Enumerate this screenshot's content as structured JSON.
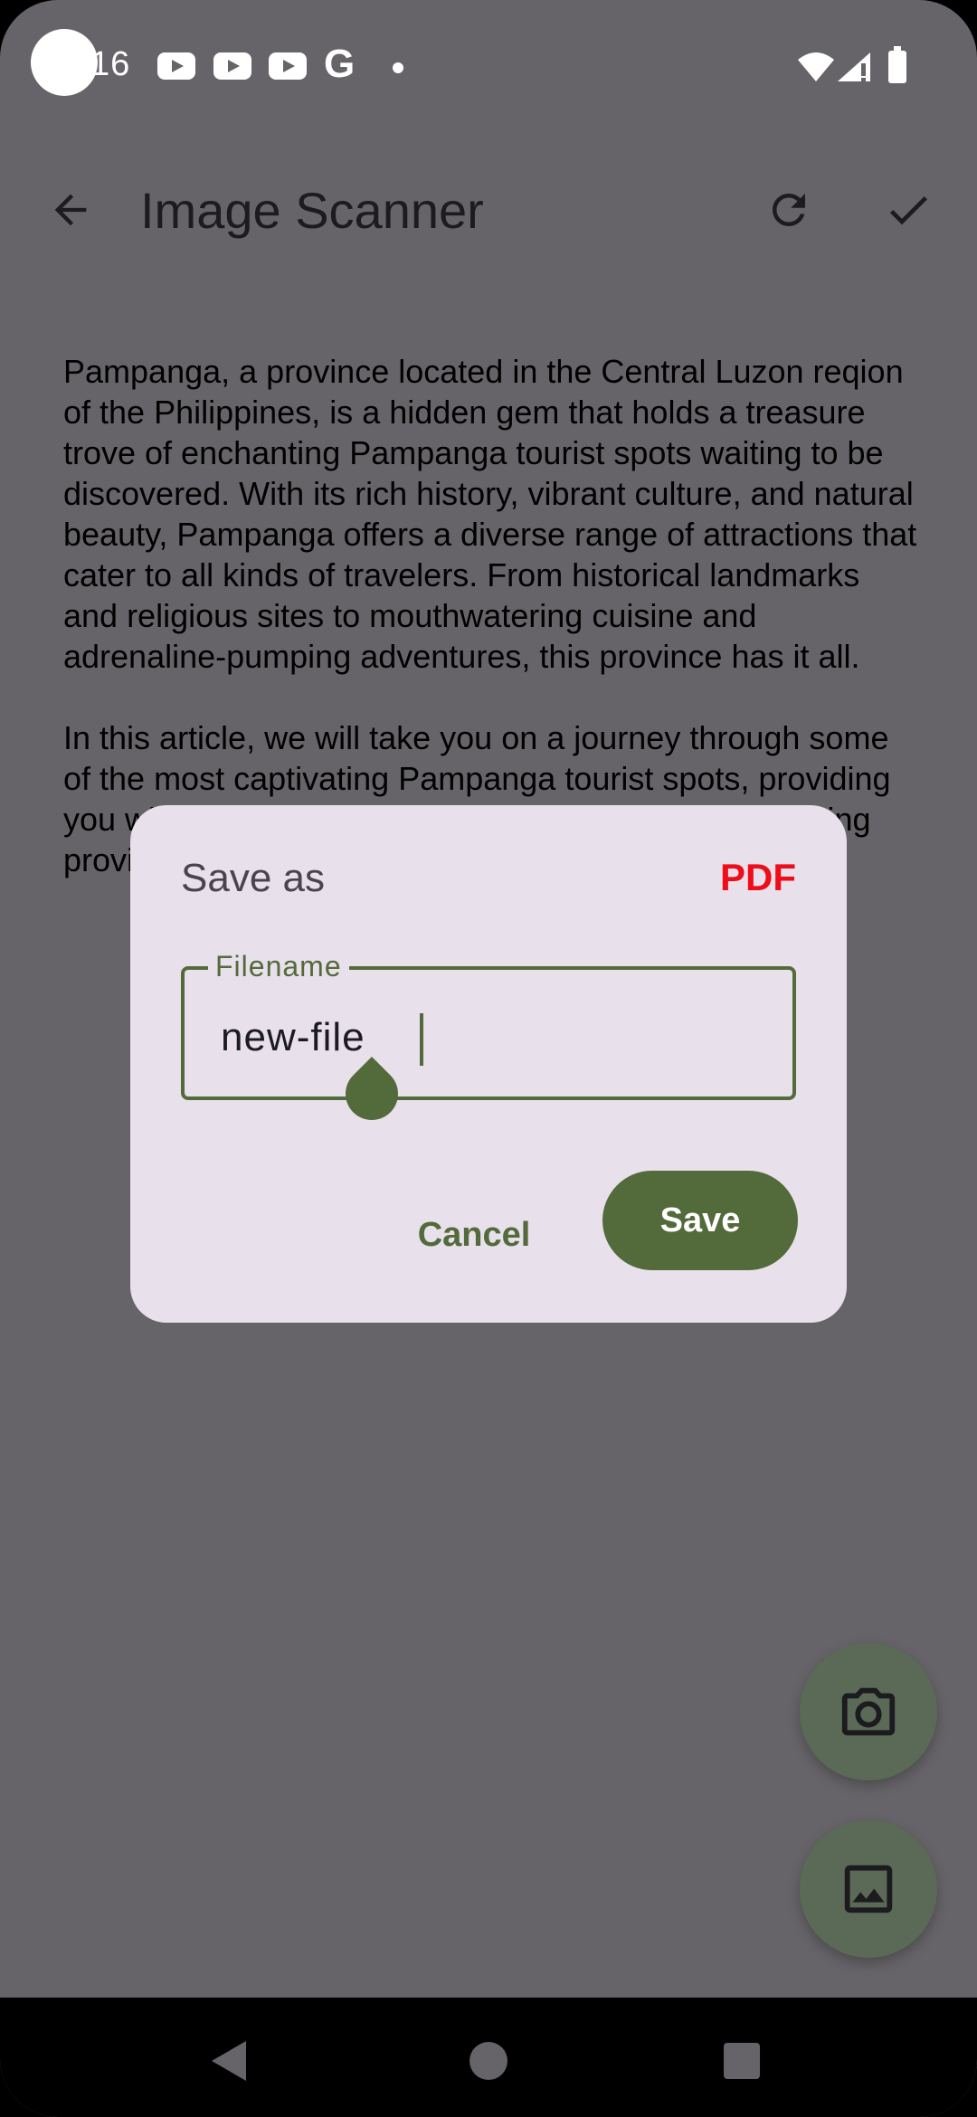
{
  "status_bar": {
    "time": "16",
    "icons": [
      "youtube-icon",
      "youtube-icon",
      "youtube-icon",
      "google-icon",
      "dot-icon",
      "wifi-icon",
      "signal-icon",
      "battery-icon"
    ],
    "google_glyph": "G"
  },
  "app_bar": {
    "title": "Image Scanner",
    "icons": [
      "arrow-back-icon",
      "refresh-icon",
      "check-icon"
    ]
  },
  "content": {
    "paragraph_1": "Pampanga, a province located in the Central Luzon reqion of the Philippines, is a hidden gem that holds a treasure trove of enchanting Pampanga tourist spots waiting to be discovered. With its rich history, vibrant culture, and natural beauty, Pampanga offers a diverse range of attractions that cater to all kinds of travelers. From historical landmarks and religious sites to mouthwatering cuisine and adrenaline-pumping adventures, this province has it all.",
    "paragraph_2": "In this article, we will take you on a journey through some of the most captivating Pampanga tourist spots, providing you with a glimpse of what awaits you in this enchanting province."
  },
  "dialog": {
    "title": "Save as",
    "format": "PDF",
    "field_label": "Filename",
    "field_value": "new-file",
    "cancel_label": "Cancel",
    "save_label": "Save"
  },
  "fabs": {
    "icons": [
      "camera-icon",
      "image-icon"
    ]
  },
  "nav_bar": {
    "icons": [
      "nav-back-icon",
      "nav-home-icon",
      "nav-recents-icon"
    ]
  },
  "colors": {
    "scrim": "#666468",
    "dialog_background": "#e8e0eb",
    "primary": "#536a3b",
    "format_accent": "#ee0d18"
  }
}
